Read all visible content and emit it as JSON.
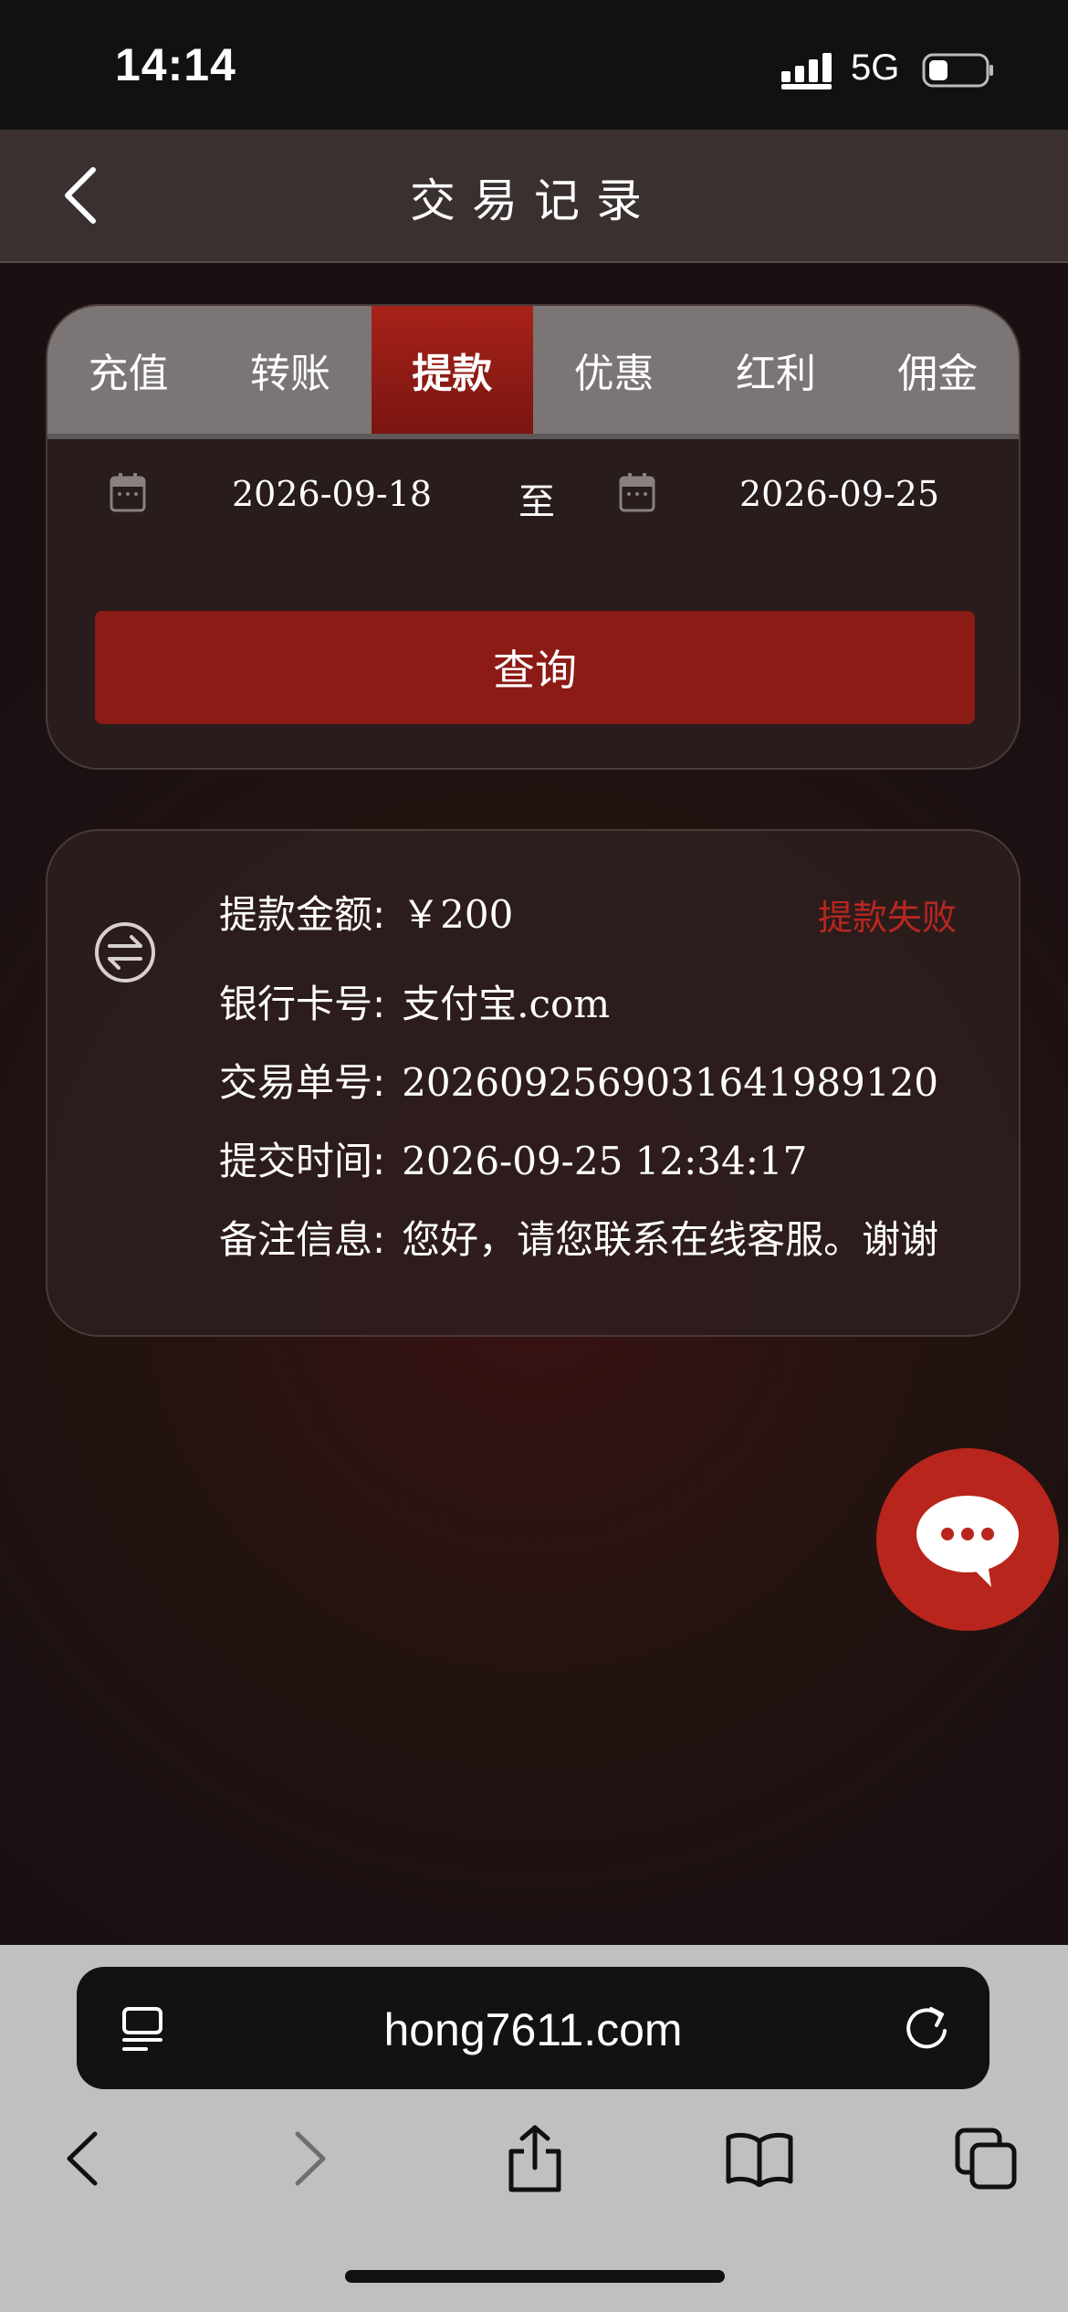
{
  "status_bar": {
    "time": "14:14",
    "network": "5G"
  },
  "header": {
    "title": "交易记录"
  },
  "tabs": [
    {
      "label": "充值",
      "active": false
    },
    {
      "label": "转账",
      "active": false
    },
    {
      "label": "提款",
      "active": true
    },
    {
      "label": "优惠",
      "active": false
    },
    {
      "label": "红利",
      "active": false
    },
    {
      "label": "佣金",
      "active": false
    }
  ],
  "filter": {
    "start_date": "2026-09-18",
    "to_label": "至",
    "end_date": "2026-09-25",
    "query_label": "查询"
  },
  "record": {
    "status": "提款失败",
    "rows": [
      {
        "label": "提款金额:",
        "value": "￥200"
      },
      {
        "label": "银行卡号:",
        "value": "支付宝.com"
      },
      {
        "label": "交易单号:",
        "value": "2026092569031641989120"
      },
      {
        "label": "提交时间:",
        "value": "2026-09-25 12:34:17"
      },
      {
        "label": "备注信息:",
        "value": "您好，请您联系在线客服。谢谢"
      }
    ]
  },
  "browser": {
    "url": "hong7611.com"
  },
  "colors": {
    "accent_red": "#a8221b",
    "status_fail": "#b8271f",
    "tab_bg": "#7b7575"
  },
  "icons": {
    "back": "chevron-left-icon",
    "calendar": "calendar-icon",
    "swap": "swap-icon",
    "chat": "chat-bubble-icon"
  }
}
